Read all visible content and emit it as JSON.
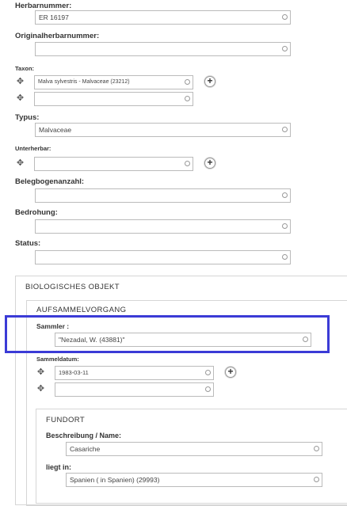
{
  "fields": {
    "herbarnummer": {
      "label": "Herbarnummer:",
      "value": "ER 16197"
    },
    "originalherbarnummer": {
      "label": "Originalherbarnummer:",
      "value": ""
    },
    "taxon": {
      "label": "Taxon:",
      "value1": "Malva sylvestris  - Malvaceae (23212)",
      "value2": ""
    },
    "typus": {
      "label": "Typus:",
      "value": "Malvaceae"
    },
    "unterherbar": {
      "label": "Unterherbar:",
      "value": ""
    },
    "belegbogenanzahl": {
      "label": "Belegbogenanzahl:",
      "value": ""
    },
    "bedrohung": {
      "label": "Bedrohung:",
      "value": ""
    },
    "status": {
      "label": "Status:",
      "value": ""
    }
  },
  "biologisches_objekt": {
    "title": "BIOLOGISCHES OBJEKT",
    "aufsammelvorgang": {
      "title": "AUFSAMMELVORGANG",
      "sammler": {
        "label": "Sammler :",
        "value": "\"Nezadal, W. (43881)\""
      },
      "sammeldatum": {
        "label": "Sammeldatum:",
        "value1": "1983-03-11",
        "value2": ""
      }
    },
    "fundort": {
      "title": "FUNDORT",
      "beschreibung": {
        "label": "Beschreibung / Name:",
        "value": "Casariche"
      },
      "liegt_in": {
        "label": "liegt in:",
        "value": "Spanien ( in Spanien) (29993)"
      }
    }
  },
  "icons": {
    "drag": "move-icon",
    "add": "plus-icon",
    "clear": "circle-icon"
  },
  "colors": {
    "highlight": "#3b3bd6",
    "panel_border": "#d6d6d6",
    "field_border": "#bbbbbb"
  }
}
